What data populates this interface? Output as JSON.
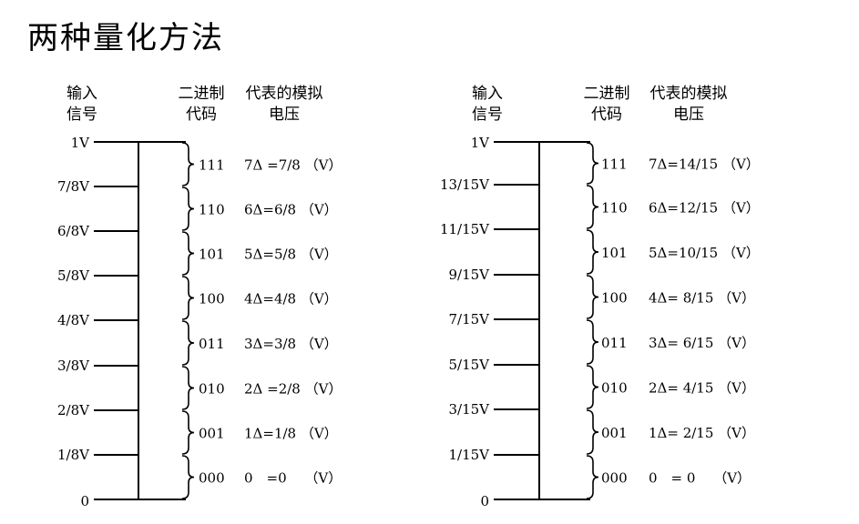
{
  "title": "两种量化方法",
  "panels": [
    {
      "headers": {
        "input": "输入\n信号",
        "binary": "二进制\n代码",
        "voltage": "代表的模拟\n电压"
      },
      "input_labels": [
        "0",
        "1/8V",
        "2/8V",
        "3/8V",
        "4/8V",
        "5/8V",
        "6/8V",
        "7/8V",
        "1V"
      ],
      "codes": [
        "000",
        "001",
        "010",
        "011",
        "100",
        "101",
        "110",
        "111"
      ],
      "voltages": [
        "0　=0　 （V）",
        "1Δ=1/8 （V）",
        "2Δ =2/8 （V）",
        "3Δ=3/8 （V）",
        "4Δ=4/8 （V）",
        "5Δ=5/8 （V）",
        "6Δ=6/8 （V）",
        "7Δ =7/8 （V）"
      ]
    },
    {
      "headers": {
        "input": "输入\n信号",
        "binary": "二进制\n代码",
        "voltage": "代表的模拟\n电压"
      },
      "input_labels": [
        "0",
        "1/15V",
        "3/15V",
        "5/15V",
        "7/15V",
        "9/15V",
        "11/15V",
        "13/15V",
        "1V"
      ],
      "codes": [
        "000",
        "001",
        "010",
        "011",
        "100",
        "101",
        "110",
        "111"
      ],
      "voltages": [
        "0　= 0　 （V）",
        "1Δ= 2/15 （V）",
        "2Δ= 4/15 （V）",
        "3Δ= 6/15 （V）",
        "4Δ= 8/15 （V）",
        "5Δ=10/15 （V）",
        "6Δ=12/15 （V）",
        "7Δ=14/15 （V）"
      ]
    }
  ]
}
